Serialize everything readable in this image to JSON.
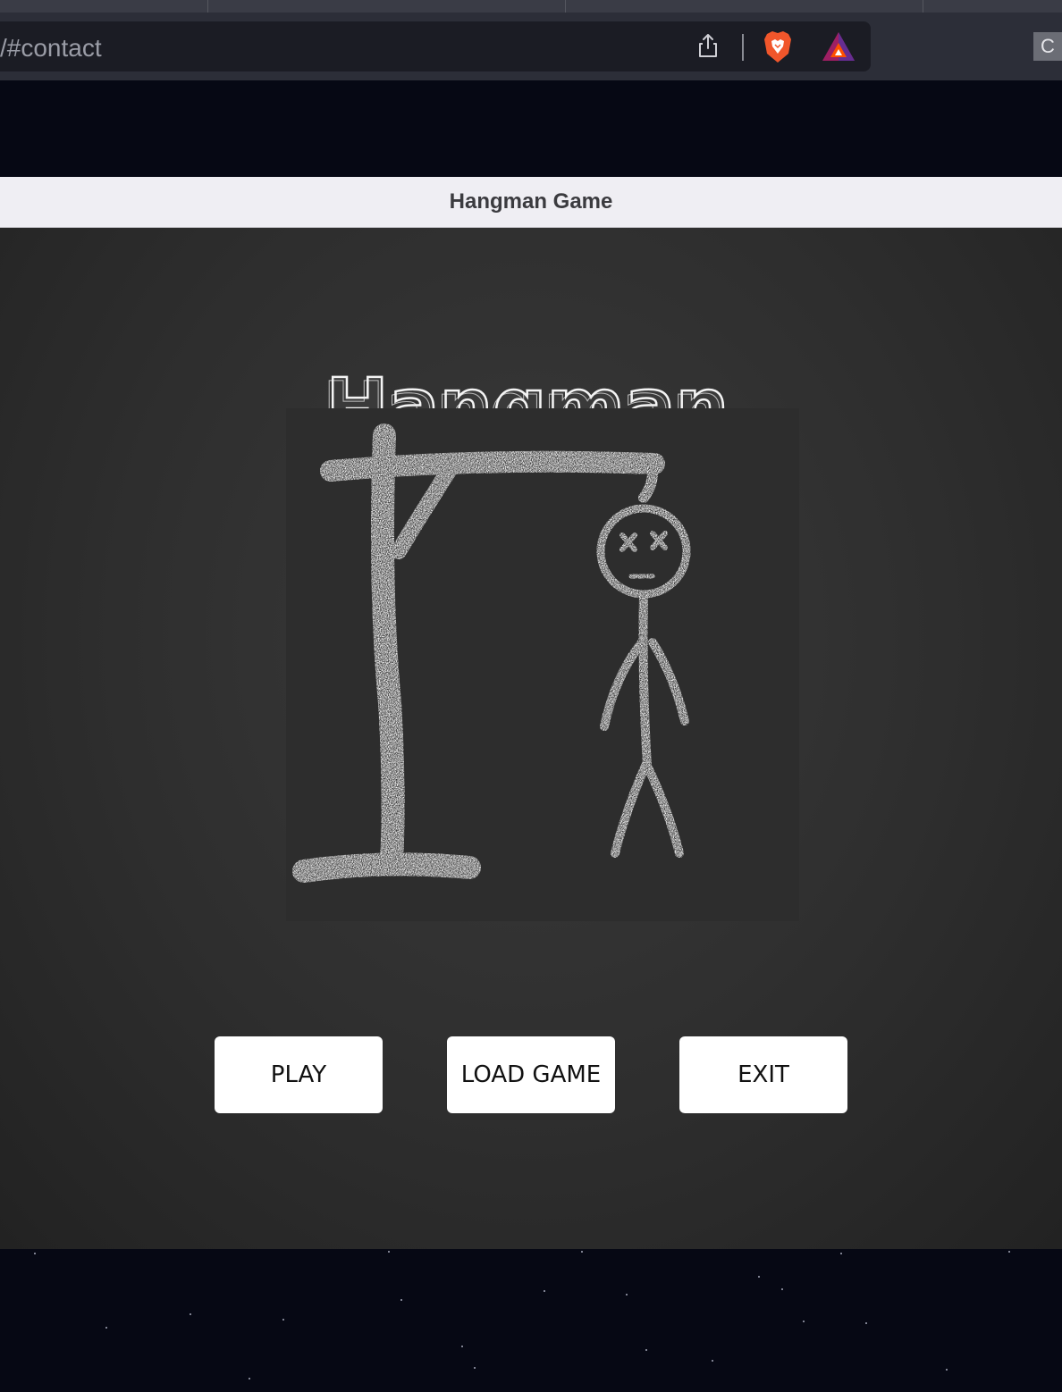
{
  "browser": {
    "url_text": "/#contact",
    "extension_letter": "C"
  },
  "window": {
    "title": "Hangman Game"
  },
  "game": {
    "logo_text": "Hangman",
    "buttons": {
      "play": "PLAY",
      "load_game": "LOAD GAME",
      "exit": "EXIT"
    }
  },
  "colors": {
    "chalk": "#ffffff",
    "board": "#2d2d2d",
    "space": "#060814",
    "titlebar": "#efeef3"
  }
}
